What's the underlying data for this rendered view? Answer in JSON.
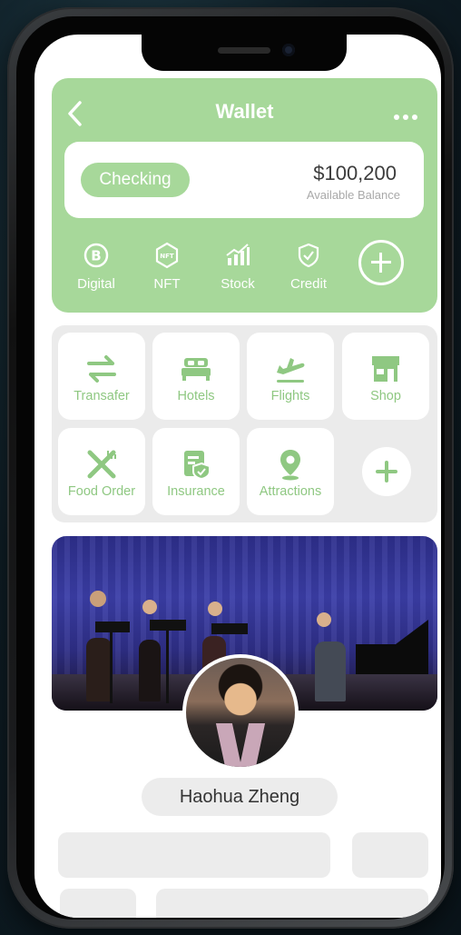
{
  "header": {
    "title": "Wallet"
  },
  "balance": {
    "account_type": "Checking",
    "amount": "$100,200",
    "caption": "Available Balance"
  },
  "asset_types": [
    {
      "label": "Digital",
      "icon": "bitcoin-icon"
    },
    {
      "label": "NFT",
      "icon": "nft-icon"
    },
    {
      "label": "Stock",
      "icon": "stock-chart-icon"
    },
    {
      "label": "Credit",
      "icon": "shield-check-icon"
    }
  ],
  "services": [
    {
      "label": "Transafer",
      "icon": "transfer-arrows-icon"
    },
    {
      "label": "Hotels",
      "icon": "bed-icon"
    },
    {
      "label": "Flights",
      "icon": "plane-icon"
    },
    {
      "label": "Shop",
      "icon": "storefront-icon"
    },
    {
      "label": "Food Order",
      "icon": "fork-knife-icon"
    },
    {
      "label": "Insurance",
      "icon": "insurance-doc-icon"
    },
    {
      "label": "Attractions",
      "icon": "map-pin-icon"
    }
  ],
  "profile": {
    "name": "Haohua Zheng"
  },
  "colors": {
    "accent": "#a7d89a",
    "accent_text": "#8fc882",
    "panel": "#ebebeb"
  }
}
